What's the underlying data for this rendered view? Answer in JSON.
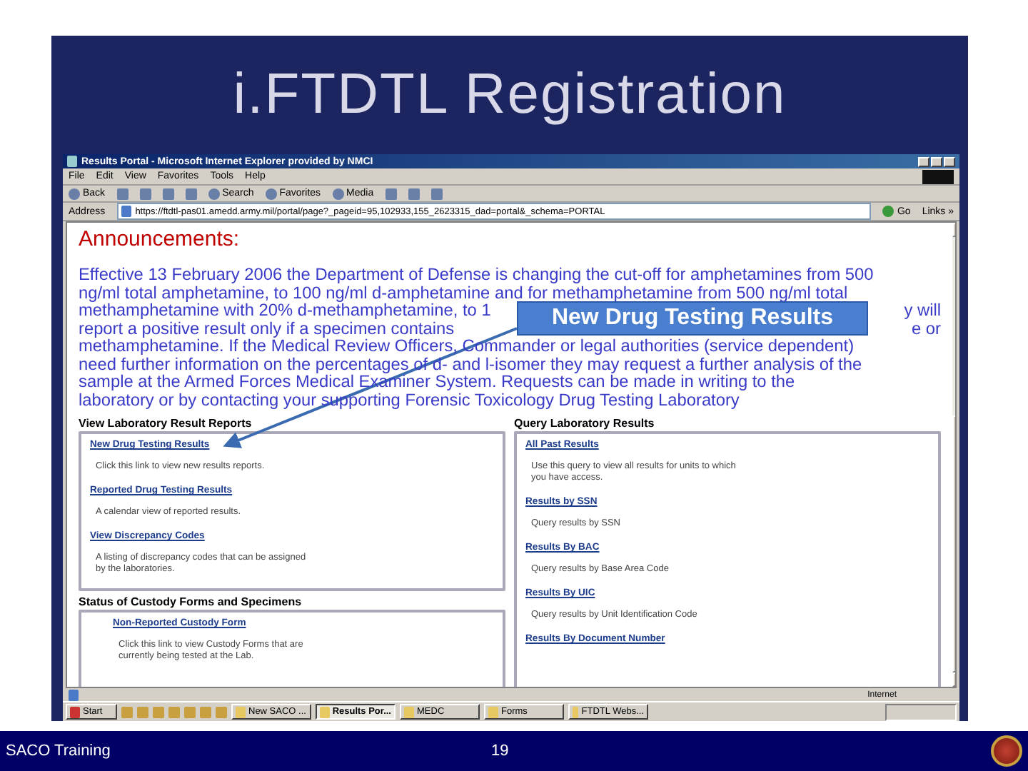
{
  "slide": {
    "title": "i.FTDTL Registration",
    "footer_left": "SACO Training",
    "page_number": "19"
  },
  "browser": {
    "title": "Results Portal - Microsoft Internet Explorer provided by NMCI",
    "menu": [
      "File",
      "Edit",
      "View",
      "Favorites",
      "Tools",
      "Help"
    ],
    "toolbar": [
      {
        "kind": "labeled",
        "label": "Back"
      },
      {
        "kind": "icon"
      },
      {
        "kind": "icon"
      },
      {
        "kind": "icon"
      },
      {
        "kind": "icon"
      },
      {
        "kind": "labeled",
        "label": "Search"
      },
      {
        "kind": "labeled",
        "label": "Favorites"
      },
      {
        "kind": "labeled",
        "label": "Media"
      },
      {
        "kind": "icon"
      },
      {
        "kind": "icon"
      },
      {
        "kind": "icon"
      }
    ],
    "address_label": "Address",
    "url": "https://ftdtl-pas01.amedd.army.mil/portal/page?_pageid=95,102933,155_2623315_dad=portal&_schema=PORTAL",
    "go": "Go",
    "links": "Links »",
    "status": "Internet"
  },
  "page": {
    "heading": "Announcements:",
    "announcement_lines": [
      {
        "left": "Effective 13 February 2006 the Department of Defense is changing the cut-off for amphetamines from 500"
      },
      {
        "left": "ng/ml total amphetamine, to 100 ng/ml d-amphetamine and for methamphetamine from  500 ng/ml total"
      },
      {
        "left": "methamphetamine with 20% d-methamphetamine, to 1",
        "right": "y will"
      },
      {
        "left": "report a positive result only if a specimen contains",
        "right": "e or"
      },
      {
        "left": "methamphetamine.  If the Medical Review Officers, Commander or legal authorities (service dependent)"
      },
      {
        "left": "need further information on the percentages of d- and l-isomer they may request a further analysis of the"
      },
      {
        "left": "sample at the Armed Forces Medical Examiner System.  Requests can be made in writing to the"
      },
      {
        "left": "laboratory or by contacting your supporting Forensic Toxicology Drug Testing Laboratory"
      }
    ],
    "left_sections": [
      {
        "title": "View Laboratory Result Reports",
        "items": [
          {
            "link": "New Drug Testing Results",
            "description": "Click this link to view new results reports."
          },
          {
            "link": "Reported Drug Testing Results",
            "description": "A calendar view of reported results."
          },
          {
            "link": "View Discrepancy Codes",
            "description": "A listing of discrepancy codes that can be assigned by the laboratories."
          }
        ]
      },
      {
        "title": "Status of Custody Forms and Specimens",
        "items": [
          {
            "link": "Non-Reported Custody Form",
            "description": "Click this link to view Custody Forms that are currently being tested at the Lab."
          }
        ]
      }
    ],
    "right_section": {
      "title": "Query Laboratory Results",
      "items": [
        {
          "link": "All Past Results",
          "description": "Use this query to view all results for units to which you have access."
        },
        {
          "link": "Results by SSN",
          "description": "Query results by SSN"
        },
        {
          "link": "Results By BAC",
          "description": "Query results by Base Area Code"
        },
        {
          "link": "Results By UIC",
          "description": "Query results by Unit Identification Code"
        },
        {
          "link": "Results By Document Number"
        }
      ]
    }
  },
  "callout": "New Drug Testing Results",
  "taskbar": {
    "start": "Start",
    "tasks": [
      {
        "label": "New SACO ...",
        "selected": false
      },
      {
        "label": "Results Por...",
        "selected": true
      },
      {
        "label": "MEDC",
        "selected": false
      },
      {
        "label": "Forms",
        "selected": false
      },
      {
        "label": "FTDTL Webs...",
        "selected": false
      }
    ]
  }
}
